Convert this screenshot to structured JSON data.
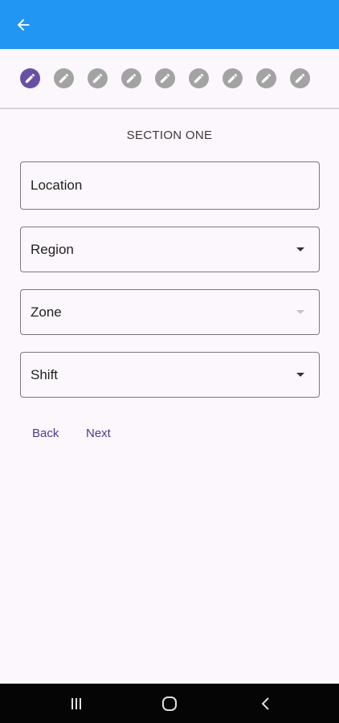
{
  "appbar": {
    "back_icon": "arrow-left-icon",
    "color": "#2196f3"
  },
  "stepper": {
    "steps": [
      {
        "state": "active",
        "icon": "pencil-icon"
      },
      {
        "state": "inactive",
        "icon": "pencil-icon"
      },
      {
        "state": "inactive",
        "icon": "pencil-icon"
      },
      {
        "state": "inactive",
        "icon": "pencil-icon"
      },
      {
        "state": "inactive",
        "icon": "pencil-icon"
      },
      {
        "state": "inactive",
        "icon": "pencil-icon"
      },
      {
        "state": "inactive",
        "icon": "pencil-icon"
      },
      {
        "state": "inactive",
        "icon": "pencil-icon"
      },
      {
        "state": "inactive",
        "icon": "pencil-icon"
      }
    ],
    "active_color": "#6750a4",
    "inactive_color": "#a3a3a3"
  },
  "form": {
    "section_title": "SECTION ONE",
    "fields": {
      "location": {
        "label": "Location",
        "type": "text"
      },
      "region": {
        "label": "Region",
        "type": "dropdown"
      },
      "zone": {
        "label": "Zone",
        "type": "dropdown",
        "disabled": true
      },
      "shift": {
        "label": "Shift",
        "type": "dropdown"
      }
    },
    "back_label": "Back",
    "next_label": "Next",
    "accent_color": "#4b3c8f"
  },
  "system_nav": {
    "recents_icon": "recents-icon",
    "home_icon": "home-icon",
    "back_icon": "back-chevron-icon"
  }
}
